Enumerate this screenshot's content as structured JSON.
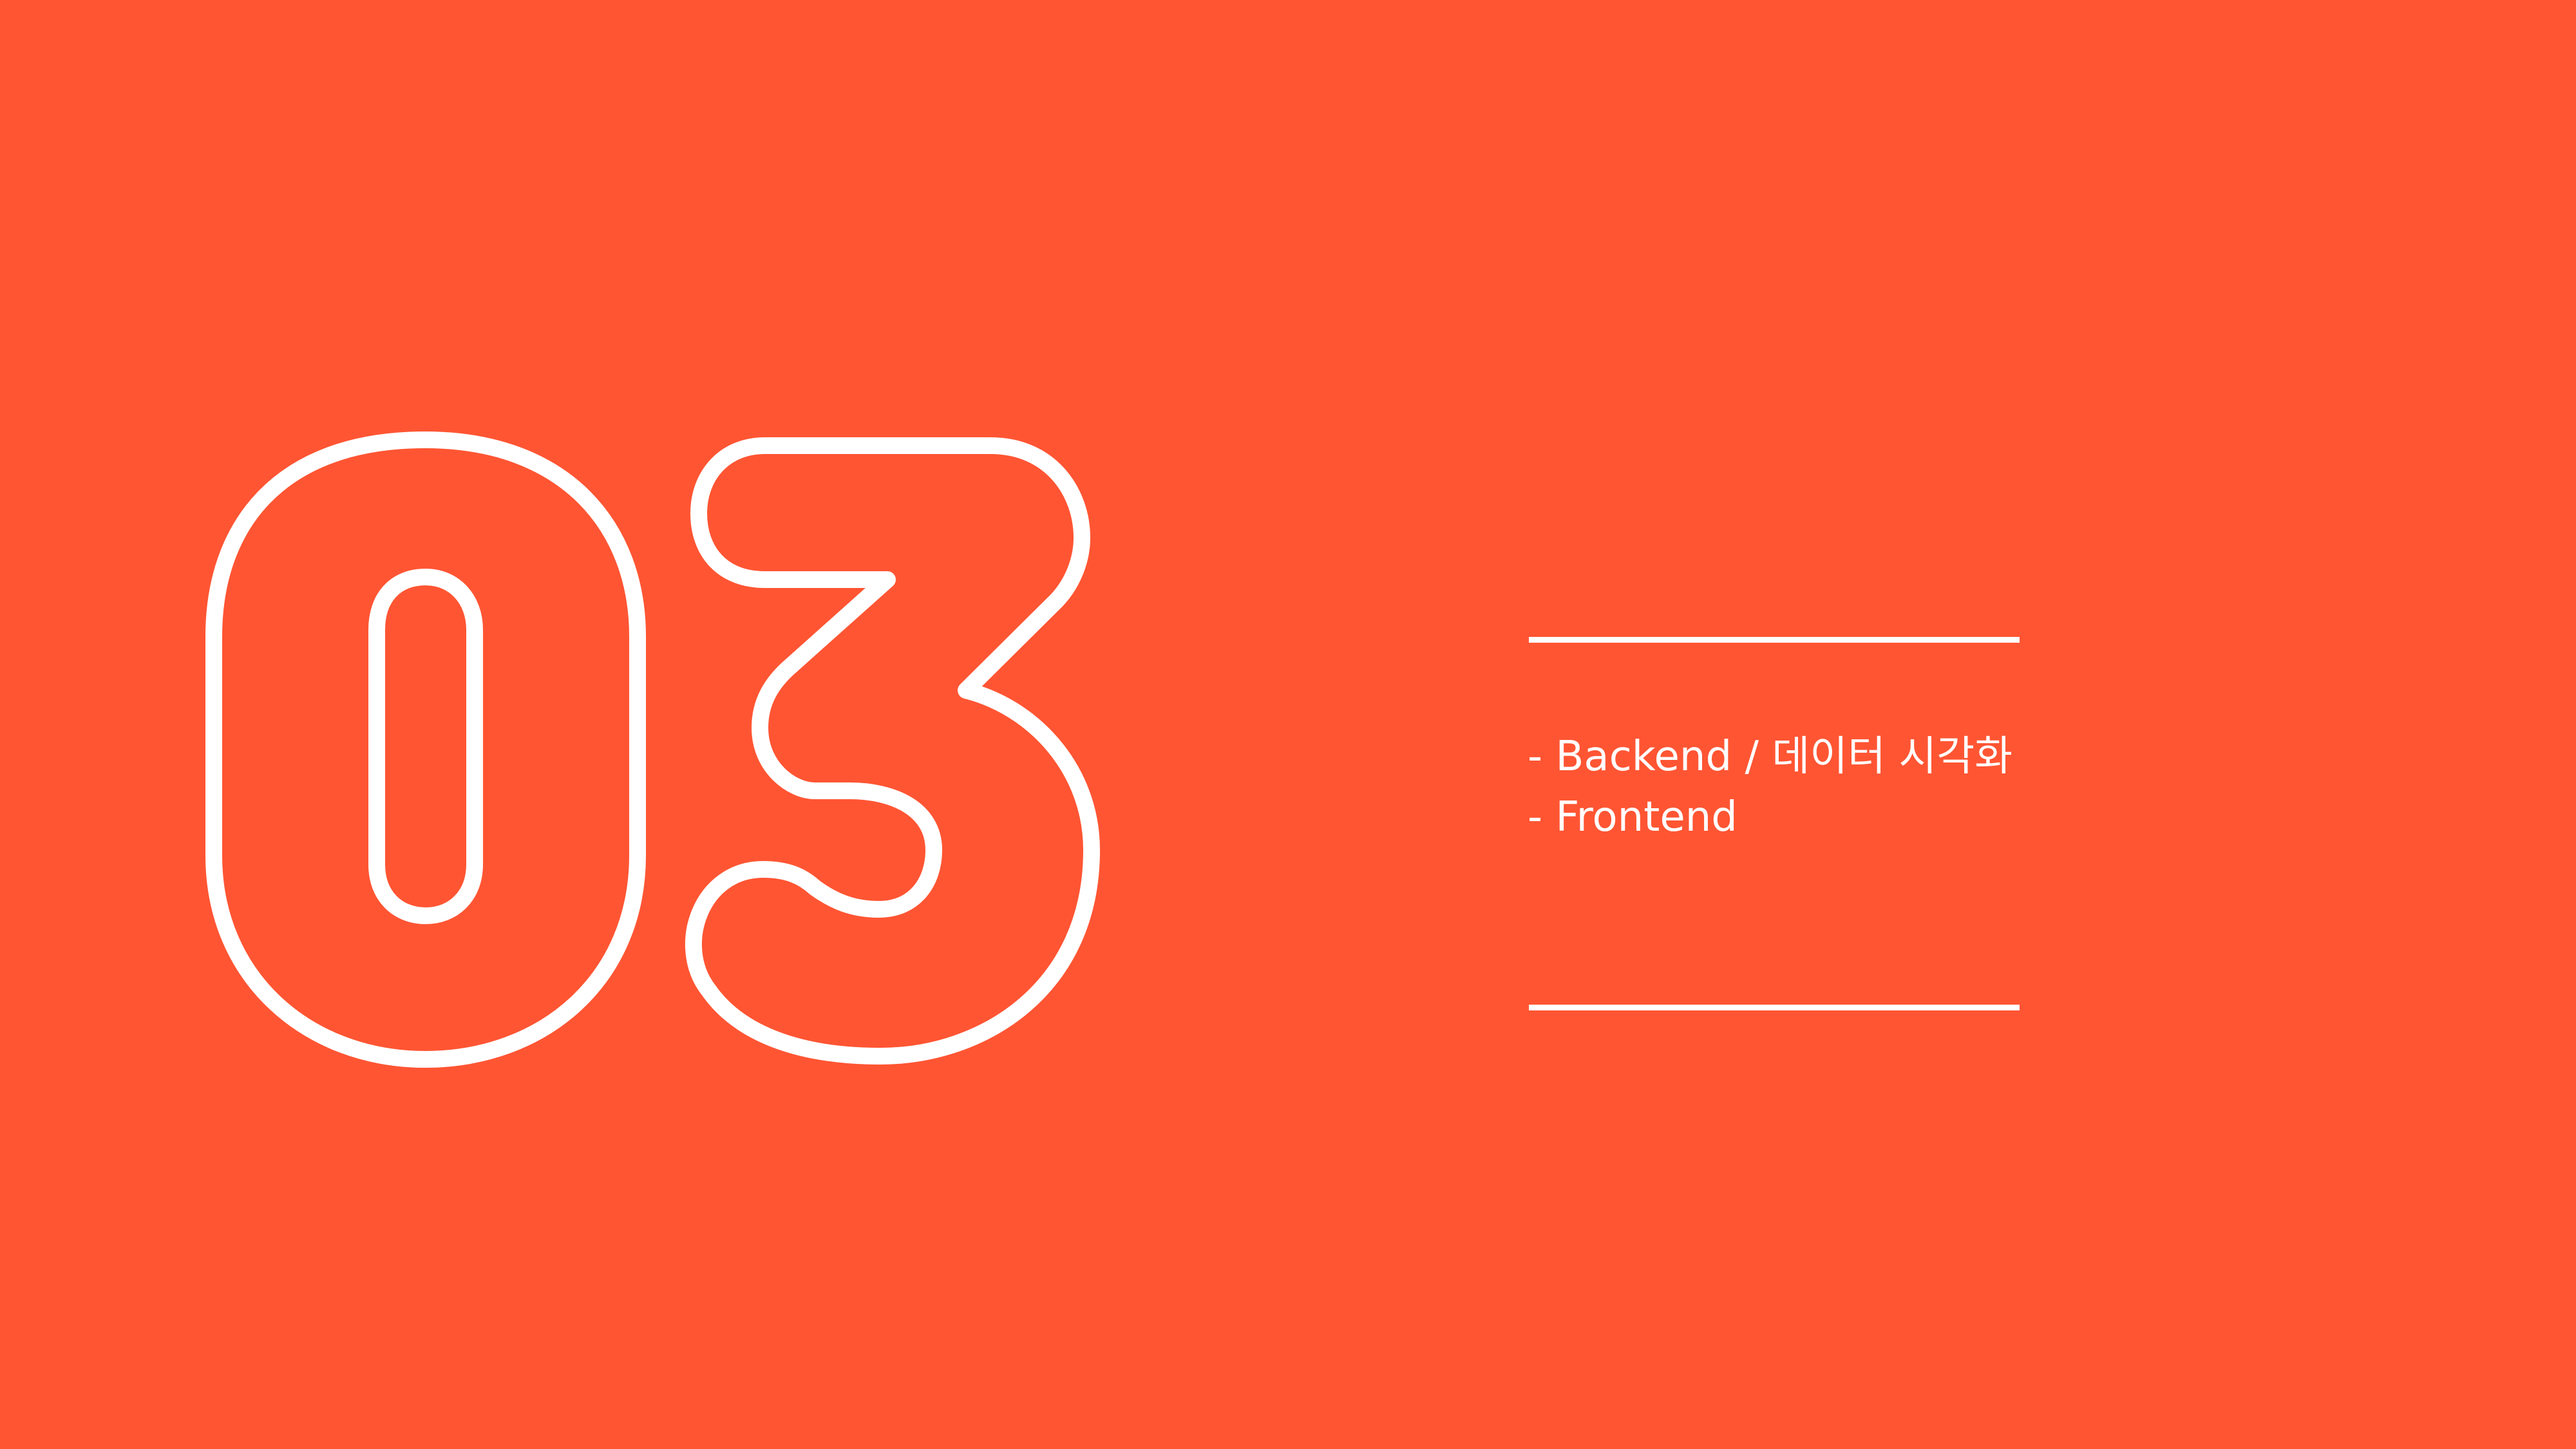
{
  "slide": {
    "background_color": "#FF5533",
    "foreground_color": "#FFFFFF",
    "section_number": "03",
    "items": [
      "- Backend / 데이터 시각화",
      "- Frontend"
    ]
  }
}
